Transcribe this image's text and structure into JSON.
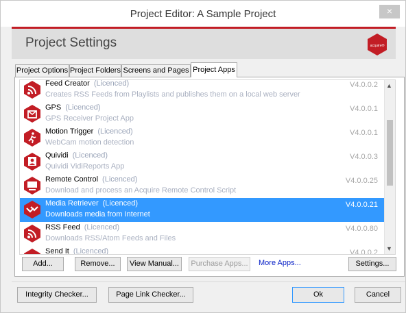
{
  "window": {
    "title": "Project Editor: A Sample Project",
    "close_label": "×"
  },
  "header": {
    "title": "Project Settings",
    "logo_text": "acquire®",
    "accent": "#c21d25"
  },
  "tabs": [
    {
      "label": "Project Options",
      "active": false
    },
    {
      "label": "Project Folders",
      "active": false
    },
    {
      "label": "Screens and Pages",
      "active": false
    },
    {
      "label": "Project Apps",
      "active": true
    }
  ],
  "apps": [
    {
      "name": "Feed Creator",
      "license": "(Licenced)",
      "description": "Creates RSS Feeds from Playlists and publishes them on a local web server",
      "version": "V4.0.0.2",
      "icon": "rss-icon",
      "selected": false
    },
    {
      "name": "GPS",
      "license": "(Licenced)",
      "description": "GPS Receiver Project App",
      "version": "V4.0.0.1",
      "icon": "gps-icon",
      "selected": false
    },
    {
      "name": "Motion Trigger",
      "license": "(Licenced)",
      "description": "WebCam motion detection",
      "version": "V4.0.0.1",
      "icon": "running-man-icon",
      "selected": false
    },
    {
      "name": "Quividi",
      "license": "(Licenced)",
      "description": "Quividi VidiReports App",
      "version": "V4.0.0.3",
      "icon": "person-screen-icon",
      "selected": false
    },
    {
      "name": "Remote Control",
      "license": "(Licenced)",
      "description": "Download and process an Acquire Remote Control Script",
      "version": "V4.0.0.25",
      "icon": "monitor-icon",
      "selected": false
    },
    {
      "name": "Media Retriever",
      "license": "(Licenced)",
      "description": "Downloads media from Internet",
      "version": "V4.0.0.21",
      "icon": "download-arrows-icon",
      "selected": true
    },
    {
      "name": "RSS Feed",
      "license": "(Licenced)",
      "description": "Downloads RSS/Atom Feeds and Files",
      "version": "V4.0.0.80",
      "icon": "rss-icon",
      "selected": false
    },
    {
      "name": "Send It",
      "license": "(Licenced)",
      "description": "",
      "version": "V4.0.0.2",
      "icon": "send-icon",
      "selected": false
    }
  ],
  "actions": {
    "add": "Add...",
    "remove": "Remove...",
    "view_manual": "View Manual...",
    "purchase": "Purchase Apps...",
    "more_apps": "More Apps...",
    "settings": "Settings..."
  },
  "footer": {
    "integrity": "Integrity Checker...",
    "page_link": "Page Link Checker...",
    "ok": "Ok",
    "cancel": "Cancel"
  }
}
